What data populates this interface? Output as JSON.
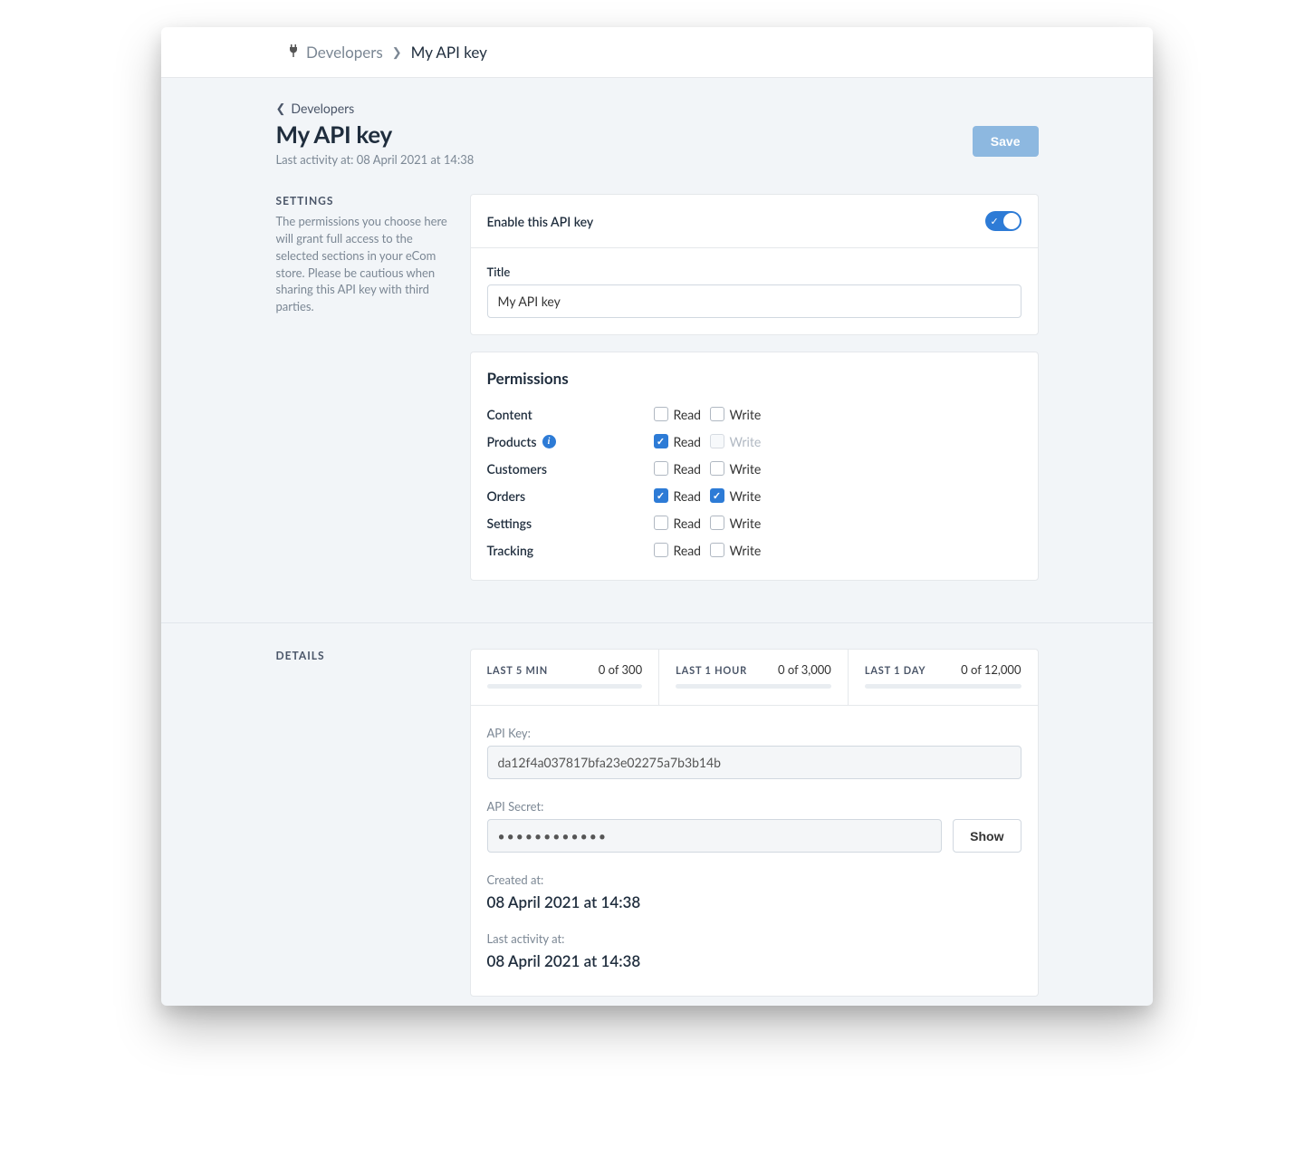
{
  "breadcrumb": {
    "parent": "Developers",
    "current": "My API key"
  },
  "backlink": "Developers",
  "page_title": "My API key",
  "subtitle": "Last activity at: 08 April 2021 at 14:38",
  "save_label": "Save",
  "settings_side": {
    "heading": "SETTINGS",
    "text": "The permissions you choose here will grant full access to the selected sections in your eCom store. Please be cautious when sharing this API key with third parties."
  },
  "enable_label": "Enable this API key",
  "title_field": {
    "label": "Title",
    "value": "My API key"
  },
  "permissions": {
    "heading": "Permissions",
    "read_label": "Read",
    "write_label": "Write",
    "rows": [
      {
        "name": "Content",
        "read": false,
        "write": false,
        "write_disabled": false
      },
      {
        "name": "Products",
        "read": true,
        "write": false,
        "write_disabled": true,
        "info": true
      },
      {
        "name": "Customers",
        "read": false,
        "write": false,
        "write_disabled": false
      },
      {
        "name": "Orders",
        "read": true,
        "write": true,
        "write_disabled": false
      },
      {
        "name": "Settings",
        "read": false,
        "write": false,
        "write_disabled": false
      },
      {
        "name": "Tracking",
        "read": false,
        "write": false,
        "write_disabled": false
      }
    ]
  },
  "details_side_heading": "DETAILS",
  "usage": [
    {
      "title": "LAST 5 MIN",
      "value": "0 of 300"
    },
    {
      "title": "LAST 1 HOUR",
      "value": "0 of 3,000"
    },
    {
      "title": "LAST 1 DAY",
      "value": "0 of 12,000"
    }
  ],
  "api_key": {
    "label": "API Key:",
    "value": "da12f4a037817bfa23e02275a7b3b14b"
  },
  "api_secret": {
    "label": "API Secret:",
    "value": "••••••••••••",
    "show_label": "Show"
  },
  "created": {
    "label": "Created at:",
    "value": "08 April 2021 at 14:38"
  },
  "activity": {
    "label": "Last activity at:",
    "value": "08 April 2021 at 14:38"
  }
}
